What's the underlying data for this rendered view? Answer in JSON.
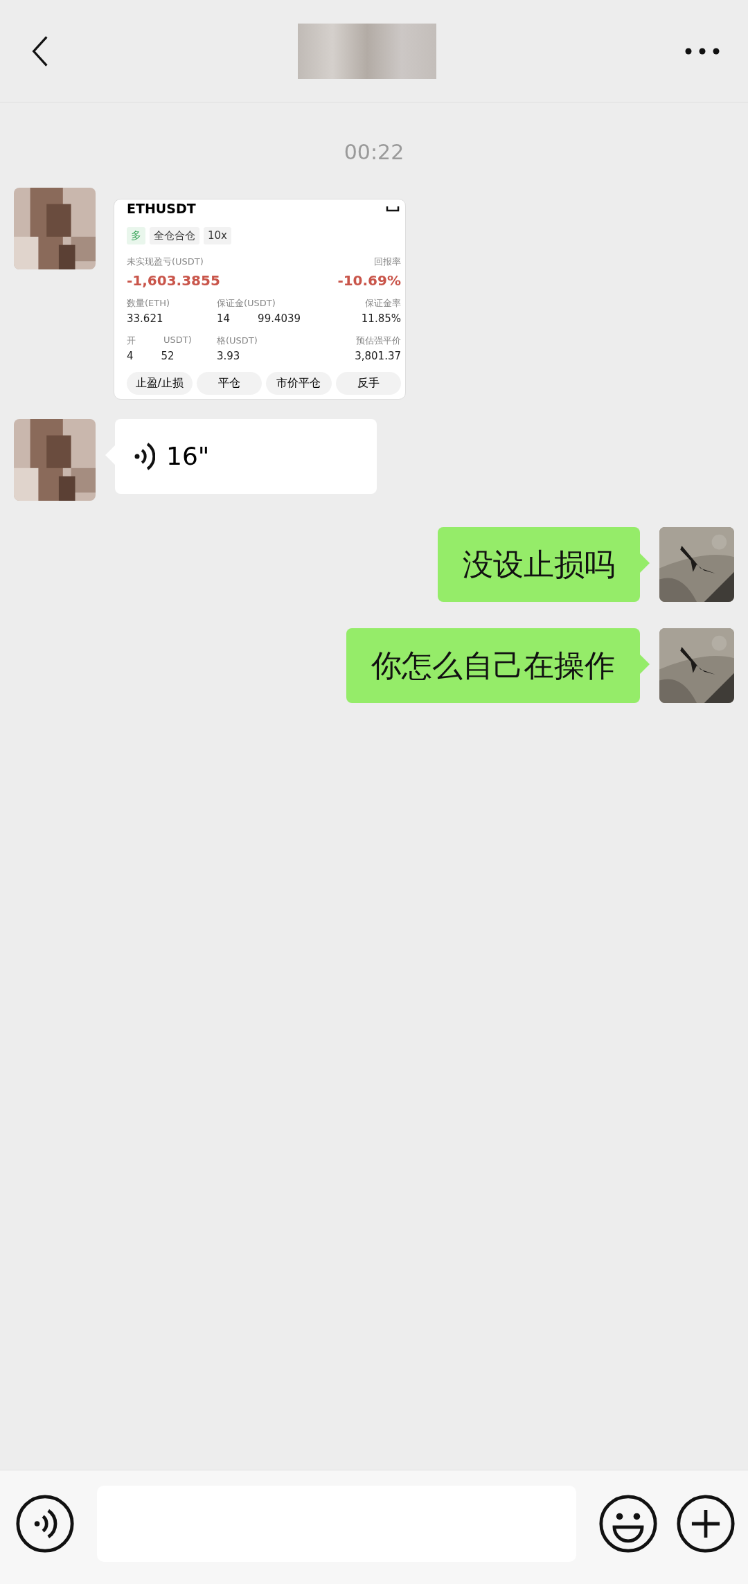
{
  "timestamp": "00:22",
  "messages": [
    {
      "kind": "card",
      "outgoing": false,
      "symbol": "ETHUSDT",
      "tags": [
        {
          "label": "多",
          "color": "#3aa55a"
        },
        {
          "label": "全仓合仓",
          "color": "#333333"
        },
        {
          "label": "10x",
          "color": "#333333"
        }
      ],
      "pnl_label": "未实现盈亏(USDT)",
      "pnl_value": "-1,603.3855",
      "roe_label": "回报率",
      "roe_value": "-10.69%",
      "stats": [
        [
          {
            "label": [
              "数量(ETH)"
            ],
            "value": [
              "33.621"
            ]
          },
          {
            "label": [
              "保证金(USDT)"
            ],
            "value": [
              "14",
              "99.4039"
            ]
          },
          {
            "label": [
              "保证金率"
            ],
            "value": [
              "11.85%"
            ]
          }
        ],
        [
          {
            "label": [
              "开",
              "USDT)"
            ],
            "value": [
              "4",
              "52"
            ]
          },
          {
            "label": [
              "格(USDT)"
            ],
            "value": [
              "3.93"
            ]
          },
          {
            "label": [
              "预估强平价"
            ],
            "value": [
              "3,801.37"
            ]
          }
        ]
      ],
      "buttons": [
        "止盈/止损",
        "平仓",
        "市价平仓",
        "反手"
      ]
    },
    {
      "kind": "voice",
      "outgoing": false,
      "duration": "16\""
    },
    {
      "kind": "text",
      "outgoing": true,
      "text": "没设止损吗"
    },
    {
      "kind": "text",
      "outgoing": true,
      "text": "你怎么自己在操作"
    }
  ]
}
